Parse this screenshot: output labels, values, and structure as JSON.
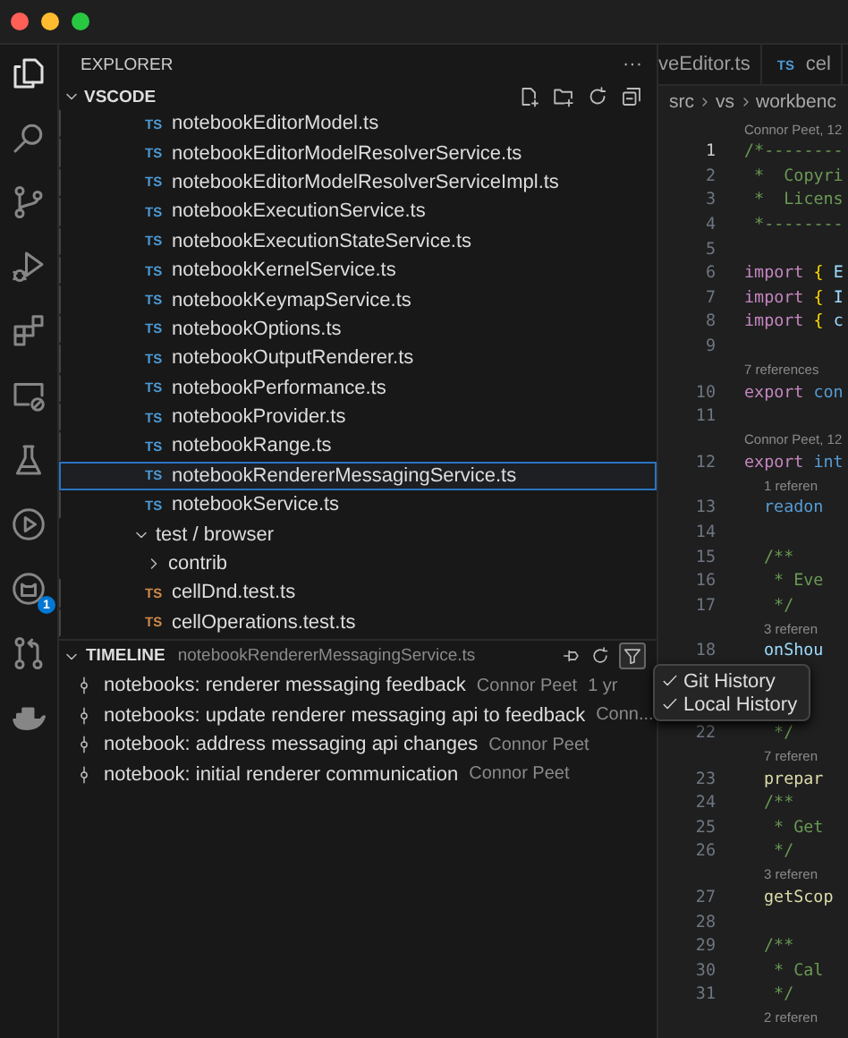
{
  "activity_bar": [
    {
      "selected": true
    },
    {
      "selected": false
    },
    {
      "selected": false
    },
    {
      "selected": false
    },
    {
      "selected": false
    },
    {
      "selected": false
    },
    {
      "selected": false
    },
    {
      "selected": false
    },
    {
      "selected": false,
      "badge": "1"
    },
    {
      "selected": false
    },
    {
      "selected": false
    }
  ],
  "explorer": {
    "title": "EXPLORER",
    "more": "···",
    "section": {
      "label": "VSCODE",
      "expanded": true
    },
    "tree": [
      {
        "children": [
          {
            "kind": "file-ts",
            "icon_label": "TS",
            "label": "notebookEditorModel.ts",
            "selected": false
          },
          {
            "kind": "file-ts",
            "icon_label": "TS",
            "label": "notebookEditorModelResolverService.ts",
            "selected": false
          },
          {
            "kind": "file-ts",
            "icon_label": "TS",
            "label": "notebookEditorModelResolverServiceImpl.ts",
            "selected": false
          },
          {
            "kind": "file-ts",
            "icon_label": "TS",
            "label": "notebookExecutionService.ts",
            "selected": false
          },
          {
            "kind": "file-ts",
            "icon_label": "TS",
            "label": "notebookExecutionStateService.ts",
            "selected": false
          },
          {
            "kind": "file-ts",
            "icon_label": "TS",
            "label": "notebookKernelService.ts",
            "selected": false
          },
          {
            "kind": "file-ts",
            "icon_label": "TS",
            "label": "notebookKeymapService.ts",
            "selected": false
          },
          {
            "kind": "file-ts",
            "icon_label": "TS",
            "label": "notebookOptions.ts",
            "selected": false
          },
          {
            "kind": "file-ts",
            "icon_label": "TS",
            "label": "notebookOutputRenderer.ts",
            "selected": false
          },
          {
            "kind": "file-ts",
            "icon_label": "TS",
            "label": "notebookPerformance.ts",
            "selected": false
          },
          {
            "kind": "file-ts",
            "icon_label": "TS",
            "label": "notebookProvider.ts",
            "selected": false
          },
          {
            "kind": "file-ts",
            "icon_label": "TS",
            "label": "notebookRange.ts",
            "selected": false
          },
          {
            "kind": "file-ts",
            "icon_label": "TS",
            "label": "notebookRendererMessagingService.ts",
            "selected": true
          },
          {
            "kind": "file-ts",
            "icon_label": "TS",
            "label": "notebookService.ts",
            "selected": false
          }
        ]
      },
      {
        "kind": "folder",
        "label": "test / browser",
        "expanded": true,
        "selected": false,
        "children": [
          {
            "kind": "folder",
            "label": "contrib",
            "expanded": false,
            "selected": false
          },
          {
            "kind": "file-test",
            "icon_label": "TS",
            "label": "cellDnd.test.ts",
            "selected": false
          },
          {
            "kind": "file-test",
            "icon_label": "TS",
            "label": "cellOperations.test.ts",
            "selected": false
          }
        ]
      }
    ]
  },
  "timeline": {
    "title": "TIMELINE",
    "file": "notebookRendererMessagingService.ts",
    "expanded": true,
    "filter_open": true,
    "items": [
      {
        "message": "notebooks: renderer messaging feedback",
        "author": "Connor Peet",
        "time": "1 yr"
      },
      {
        "message": "notebooks: update renderer messaging api to feedback",
        "author": "Conn..."
      },
      {
        "message": "notebook: address messaging api changes",
        "author": "Connor Peet"
      },
      {
        "message": "notebook: initial renderer communication",
        "author": "Connor Peet"
      }
    ]
  },
  "filter_menu": {
    "items": [
      {
        "label": "Git History",
        "checked": true
      },
      {
        "label": "Local History",
        "checked": true
      }
    ]
  },
  "tabs": [
    {
      "label": "veEditor.ts",
      "selected": false
    },
    {
      "icon_label": "TS",
      "label": "cel",
      "selected": false
    }
  ],
  "breadcrumb": [
    "src",
    "vs",
    "workbenc"
  ],
  "editor": {
    "rows": [
      {
        "kind": "lens",
        "text": "Connor Peet, 12"
      },
      {
        "kind": "code",
        "number": "1",
        "current": true,
        "tokens": [
          {
            "kind": "comment",
            "text": "/*--------"
          }
        ]
      },
      {
        "kind": "code",
        "number": "2",
        "current": false,
        "tokens": [
          {
            "kind": "comment",
            "text": " *  Copyri"
          }
        ]
      },
      {
        "kind": "code",
        "number": "3",
        "current": false,
        "tokens": [
          {
            "kind": "comment",
            "text": " *  Licens"
          }
        ]
      },
      {
        "kind": "code",
        "number": "4",
        "current": false,
        "tokens": [
          {
            "kind": "comment",
            "text": " *--------"
          }
        ]
      },
      {
        "kind": "code",
        "number": "5",
        "current": false
      },
      {
        "kind": "code",
        "number": "6",
        "current": false,
        "tokens": [
          {
            "kind": "keyword",
            "text": "import"
          },
          {
            "kind": "brace",
            "text": " {"
          },
          {
            "kind": "ident",
            "text": " E"
          }
        ]
      },
      {
        "kind": "code",
        "number": "7",
        "current": false,
        "tokens": [
          {
            "kind": "keyword",
            "text": "import"
          },
          {
            "kind": "brace",
            "text": " {"
          },
          {
            "kind": "ident",
            "text": " I"
          }
        ]
      },
      {
        "kind": "code",
        "number": "8",
        "current": false,
        "tokens": [
          {
            "kind": "keyword",
            "text": "import"
          },
          {
            "kind": "brace",
            "text": " {"
          },
          {
            "kind": "ident",
            "text": " c"
          }
        ]
      },
      {
        "kind": "code",
        "number": "9",
        "current": false
      },
      {
        "kind": "lens",
        "text": "7 references"
      },
      {
        "kind": "code",
        "number": "10",
        "current": false,
        "tokens": [
          {
            "kind": "keyword",
            "text": "export"
          },
          {
            "kind": "storage",
            "text": " con"
          }
        ]
      },
      {
        "kind": "code",
        "number": "11",
        "current": false
      },
      {
        "kind": "lens",
        "text": "Connor Peet, 12"
      },
      {
        "kind": "code",
        "number": "12",
        "current": false,
        "tokens": [
          {
            "kind": "keyword",
            "text": "export"
          },
          {
            "kind": "storage",
            "text": " int"
          }
        ]
      },
      {
        "kind": "lens-nested",
        "text": "1 referen"
      },
      {
        "kind": "code-nested",
        "number": "13",
        "current": false,
        "tokens": [
          {
            "kind": "storage",
            "text": "readon"
          }
        ]
      },
      {
        "kind": "code",
        "number": "14",
        "current": false
      },
      {
        "kind": "code-nested",
        "number": "15",
        "current": false,
        "tokens": [
          {
            "kind": "comment",
            "text": "/**"
          }
        ]
      },
      {
        "kind": "code-nested",
        "number": "16",
        "current": false,
        "tokens": [
          {
            "kind": "comment",
            "text": " * Eve"
          }
        ]
      },
      {
        "kind": "code-nested",
        "number": "17",
        "current": false,
        "tokens": [
          {
            "kind": "comment",
            "text": " */"
          }
        ]
      },
      {
        "kind": "lens-nested",
        "text": "3 referen"
      },
      {
        "kind": "code-nested",
        "number": "18",
        "current": false,
        "tokens": [
          {
            "kind": "ident",
            "text": "onShou"
          }
        ]
      },
      {
        "kind": "gap"
      },
      {
        "kind": "gap"
      },
      {
        "kind": "code-nested",
        "number": "22",
        "current": false,
        "tokens": [
          {
            "kind": "comment",
            "text": " */"
          }
        ]
      },
      {
        "kind": "lens-nested",
        "text": "7 referen"
      },
      {
        "kind": "code-nested",
        "number": "23",
        "current": false,
        "tokens": [
          {
            "kind": "func",
            "text": "prepar"
          }
        ]
      },
      {
        "kind": "code-nested",
        "number": "24",
        "current": false,
        "tokens": [
          {
            "kind": "comment",
            "text": "/**"
          }
        ]
      },
      {
        "kind": "code-nested",
        "number": "25",
        "current": false,
        "tokens": [
          {
            "kind": "comment",
            "text": " * Get"
          }
        ]
      },
      {
        "kind": "code-nested",
        "number": "26",
        "current": false,
        "tokens": [
          {
            "kind": "comment",
            "text": " */"
          }
        ]
      },
      {
        "kind": "lens-nested",
        "text": "3 referen"
      },
      {
        "kind": "code-nested",
        "number": "27",
        "current": false,
        "tokens": [
          {
            "kind": "func",
            "text": "getScop"
          }
        ]
      },
      {
        "kind": "code",
        "number": "28",
        "current": false
      },
      {
        "kind": "code-nested",
        "number": "29",
        "current": false,
        "tokens": [
          {
            "kind": "comment",
            "text": "/**"
          }
        ]
      },
      {
        "kind": "code-nested",
        "number": "30",
        "current": false,
        "tokens": [
          {
            "kind": "comment",
            "text": " * Cal"
          }
        ]
      },
      {
        "kind": "code-nested",
        "number": "31",
        "current": false,
        "tokens": [
          {
            "kind": "comment",
            "text": " */"
          }
        ]
      },
      {
        "kind": "lens-nested",
        "text": "2 referen"
      }
    ]
  }
}
